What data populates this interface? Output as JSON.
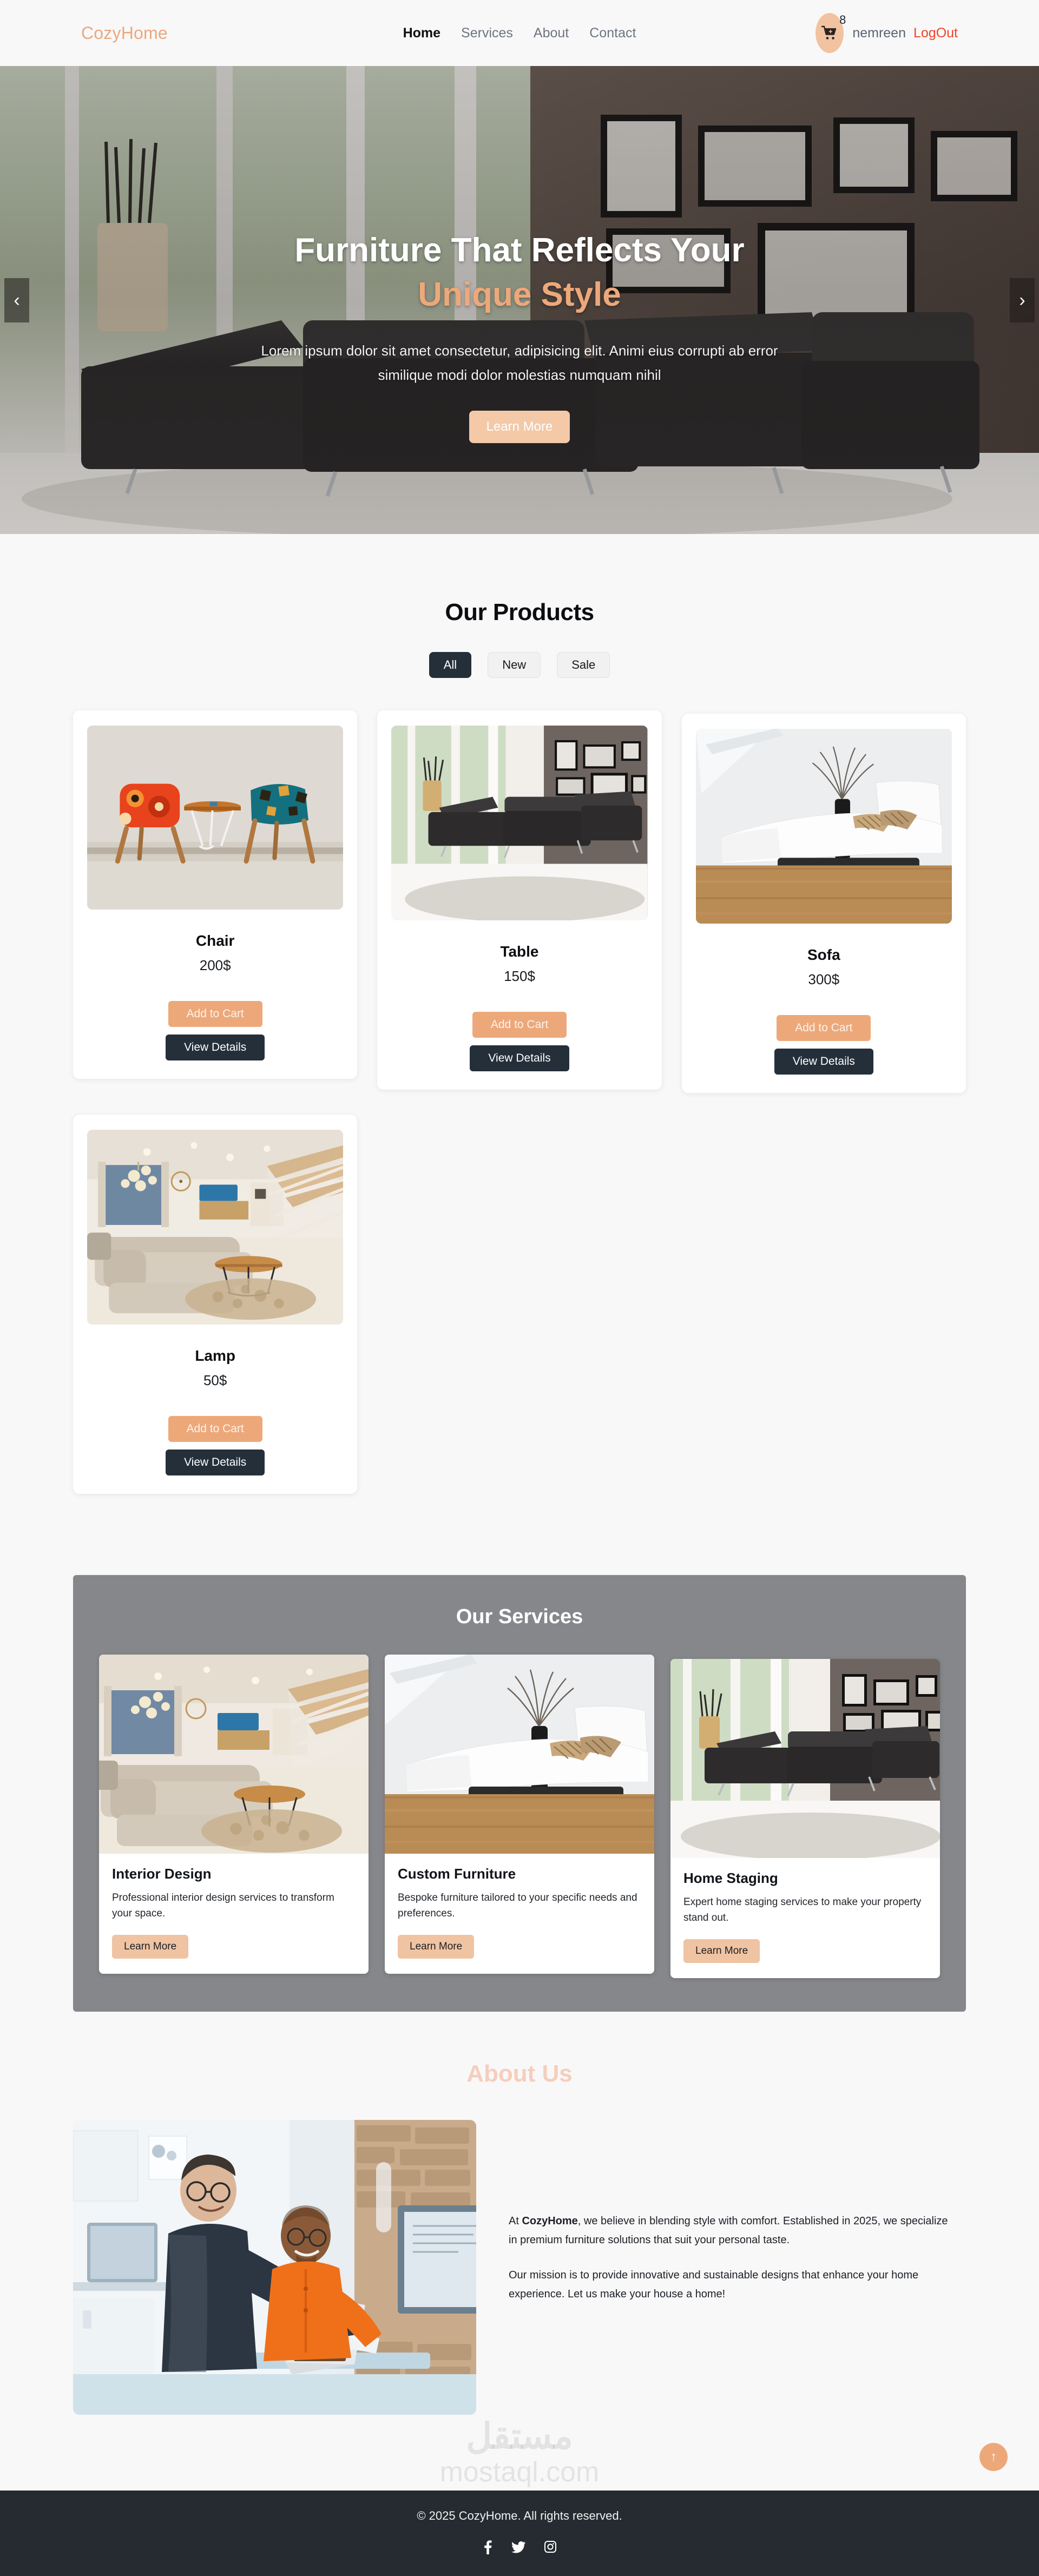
{
  "navbar": {
    "brand": "CozyHome",
    "links": [
      {
        "label": "Home",
        "active": true
      },
      {
        "label": "Services",
        "active": false
      },
      {
        "label": "About",
        "active": false
      },
      {
        "label": "Contact",
        "active": false
      }
    ],
    "cart": {
      "icon": "shopping-cart-plus-icon",
      "badge": "8"
    },
    "username": "nemreen",
    "logout": "LogOut",
    "brand_color": "#eba87d",
    "logout_color": "#f0442a"
  },
  "hero": {
    "title_main": "Furniture That Reflects Your ",
    "title_accent": "Unique Style",
    "subtitle": "Lorem ipsum dolor sit amet consectetur, adipisicing elit. Animi eius corrupti ab error similique modi dolor molestias numquam nihil",
    "cta": "Learn More",
    "prev_icon": "chevron-left-icon",
    "next_icon": "chevron-right-icon",
    "prev_glyph": "‹",
    "next_glyph": "›",
    "accent_color": "#eda87a"
  },
  "products": {
    "title": "Our Products",
    "filters": [
      {
        "label": "All",
        "active": true
      },
      {
        "label": "New",
        "active": false
      },
      {
        "label": "Sale",
        "active": false
      }
    ],
    "add_label": "Add to Cart",
    "view_label": "View Details",
    "items": [
      {
        "name": "Chair",
        "price": "200$",
        "image": "two-patterned-chairs-with-round-table"
      },
      {
        "name": "Table",
        "price": "150$",
        "image": "black-sectional-sofa-in-living-room"
      },
      {
        "name": "Sofa",
        "price": "300$",
        "image": "white-chaise-lounge-on-brown-rug"
      },
      {
        "name": "Lamp",
        "price": "50$",
        "image": "modern-living-room-with-staircase"
      }
    ]
  },
  "services": {
    "title": "Our Services",
    "learn_label": "Learn More",
    "items": [
      {
        "name": "Interior Design",
        "desc": "Professional interior design services to transform your space.",
        "image": "modern-living-room-with-staircase"
      },
      {
        "name": "Custom Furniture",
        "desc": "Bespoke furniture tailored to your specific needs and preferences.",
        "image": "white-chaise-lounge-on-brown-rug"
      },
      {
        "name": "Home Staging",
        "desc": "Expert home staging services to make your property stand out.",
        "image": "black-sectional-sofa-in-living-room"
      }
    ],
    "bg_color": "#86878a"
  },
  "about": {
    "title": "About Us",
    "image": "two-men-at-laptop-in-showroom",
    "paragraph1_lead": "At ",
    "paragraph1_brand": "CozyHome",
    "paragraph1_rest": ", we believe in blending style with comfort. Established in 2025, we specialize in premium furniture solutions that suit your personal taste.",
    "paragraph2": "Our mission is to provide innovative and sustainable designs that enhance your home experience. Let us make your house a home!",
    "title_color": "#f6cdbc"
  },
  "watermark": {
    "arabic": "مستقل",
    "latin": "mostaql.com"
  },
  "scroll_top": {
    "icon": "arrow-up-icon",
    "glyph": "↑"
  },
  "footer": {
    "copyright": "© 2025 CozyHome. All rights reserved.",
    "social": [
      {
        "name": "facebook-icon"
      },
      {
        "name": "twitter-icon"
      },
      {
        "name": "instagram-icon"
      }
    ],
    "bg_color": "#262b31"
  }
}
